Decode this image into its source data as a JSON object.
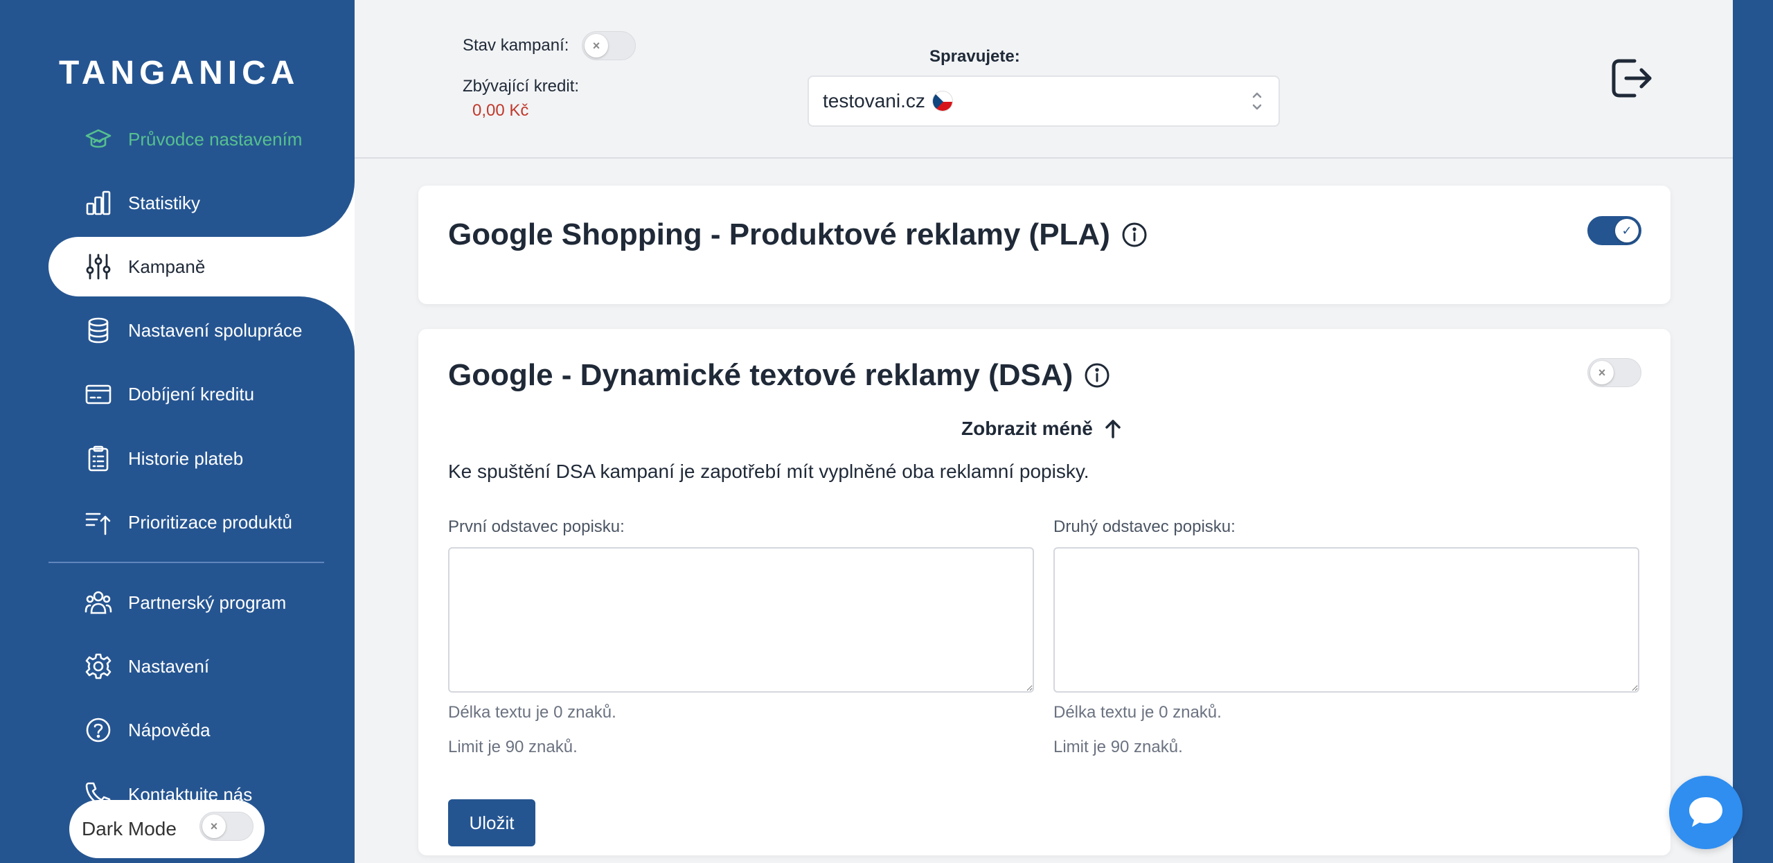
{
  "sidebar": {
    "logo": "TANGANICA",
    "items": [
      {
        "label": "Průvodce nastavením",
        "icon": "graduation-cap-icon"
      },
      {
        "label": "Statistiky",
        "icon": "bar-chart-icon"
      },
      {
        "label": "Kampaně",
        "icon": "sliders-icon"
      },
      {
        "label": "Nastavení spolupráce",
        "icon": "database-icon"
      },
      {
        "label": "Dobíjení kreditu",
        "icon": "credit-card-icon"
      },
      {
        "label": "Historie plateb",
        "icon": "clipboard-icon"
      },
      {
        "label": "Prioritizace produktů",
        "icon": "sort-up-icon"
      },
      {
        "label": "Partnerský program",
        "icon": "users-icon"
      },
      {
        "label": "Nastavení",
        "icon": "gear-icon"
      },
      {
        "label": "Nápověda",
        "icon": "help-circle-icon"
      },
      {
        "label": "Kontaktujte nás",
        "icon": "phone-icon"
      }
    ],
    "active_index": 2,
    "dark_mode": {
      "label": "Dark Mode",
      "enabled": false
    }
  },
  "header": {
    "campaign_status_label": "Stav kampaní:",
    "campaign_status_enabled": false,
    "credit_label": "Zbývající kredit:",
    "credit_value": "0,00 Kč",
    "managing_label": "Spravujete:",
    "managed_site": "testovani.cz"
  },
  "cards": [
    {
      "title": "Google Shopping - Produktové reklamy (PLA)",
      "enabled": true
    },
    {
      "title": "Google - Dynamické textové reklamy (DSA)",
      "enabled": false,
      "show_less_label": "Zobrazit méně",
      "description": "Ke spuštění DSA kampaní je zapotřebí mít vyplněné oba reklamní popisky.",
      "fields": [
        {
          "label": "První odstavec popisku:",
          "value": "",
          "length_hint": "Délka textu je 0 znaků.",
          "limit_hint": "Limit je 90 znaků."
        },
        {
          "label": "Druhý odstavec popisku:",
          "value": "",
          "length_hint": "Délka textu je 0 znaků.",
          "limit_hint": "Limit je 90 znaků."
        }
      ],
      "save_label": "Uložit"
    }
  ],
  "colors": {
    "sidebar": "#255591",
    "accent_green": "#56c08f",
    "credit_red": "#c0392b",
    "chat": "#2f8ef0"
  }
}
